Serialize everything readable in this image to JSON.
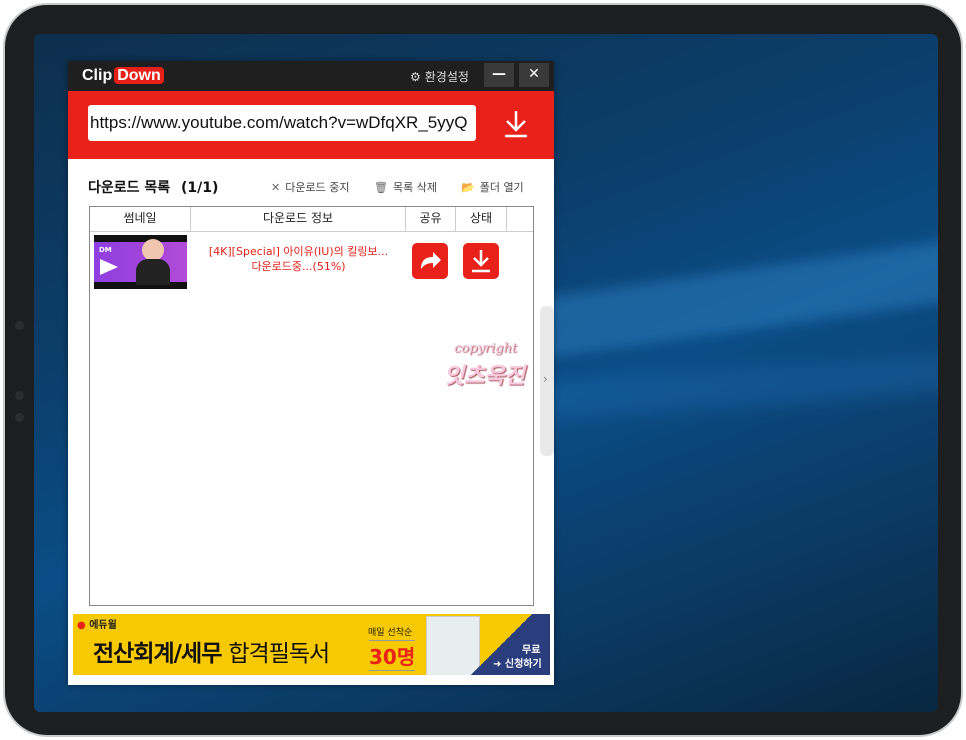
{
  "app": {
    "logo_clip": "Clip",
    "logo_down": "Down",
    "settings_label": "환경설정",
    "minimize_label": "—",
    "close_label": "✕"
  },
  "url": {
    "value": "https://www.youtube.com/watch?v=wDfqXR_5yyQ"
  },
  "list": {
    "title": "다운로드 목록",
    "count": "(1/1)",
    "toolbar": {
      "stop_label": "다운로드 중지",
      "delete_label": "목록 삭제",
      "open_folder_label": "폴더 열기"
    },
    "columns": [
      "썸네일",
      "다운로드 정보",
      "공유",
      "상태"
    ],
    "rows": [
      {
        "title": "[4K][Special] 아이유(IU)의 킬링보...",
        "status": "다운로드중...(51%)",
        "progress": 0.51
      }
    ]
  },
  "watermark": {
    "line1": "copyright",
    "line2": "잇츠욱진"
  },
  "ad": {
    "brand": "에듀윌",
    "headline_bold": "전산회계/세무",
    "headline_light": "합격필독서",
    "daily_label": "매일 선착순",
    "count": "30명",
    "cta_free": "무료",
    "cta_apply": "신청하기"
  },
  "colors": {
    "accent": "#e8221a",
    "titlebar": "#1f1f1f",
    "ad_bg": "#f7c900"
  }
}
